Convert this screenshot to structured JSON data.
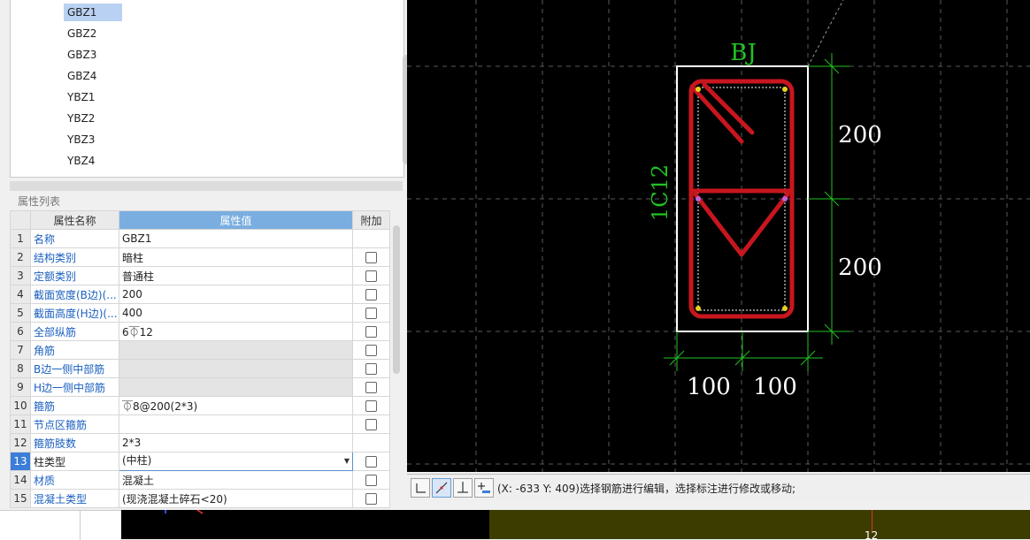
{
  "tree": {
    "items": [
      "GBZ1",
      "GBZ2",
      "GBZ3",
      "GBZ4",
      "YBZ1",
      "YBZ2",
      "YBZ3",
      "YBZ4"
    ],
    "selected_index": 0
  },
  "props": {
    "title": "属性列表",
    "col_name": "属性名称",
    "col_value": "属性值",
    "col_extra": "附加",
    "rows": [
      {
        "num": "1",
        "name": "名称",
        "value": "GBZ1"
      },
      {
        "num": "2",
        "name": "结构类别",
        "value": "暗柱"
      },
      {
        "num": "3",
        "name": "定额类别",
        "value": "普通柱"
      },
      {
        "num": "4",
        "name": "截面宽度(B边)(...",
        "value": "200"
      },
      {
        "num": "5",
        "name": "截面高度(H边)(...",
        "value": "400"
      },
      {
        "num": "6",
        "name": "全部纵筋",
        "value": "6⏁12"
      },
      {
        "num": "7",
        "name": "角筋",
        "value": ""
      },
      {
        "num": "8",
        "name": "B边一侧中部筋",
        "value": ""
      },
      {
        "num": "9",
        "name": "H边一侧中部筋",
        "value": ""
      },
      {
        "num": "10",
        "name": "箍筋",
        "value": "⏁8@200(2*3)"
      },
      {
        "num": "11",
        "name": "节点区箍筋",
        "value": ""
      },
      {
        "num": "12",
        "name": "箍筋肢数",
        "value": "2*3"
      },
      {
        "num": "13",
        "name": "柱类型",
        "value": "(中柱)"
      },
      {
        "num": "14",
        "name": "材质",
        "value": "混凝土"
      },
      {
        "num": "15",
        "name": "混凝土类型",
        "value": "(现浇混凝土碎石<20)"
      }
    ]
  },
  "drawing": {
    "label_top": "BJ",
    "label_side": "1C12",
    "dim_right_top": "200",
    "dim_right_bottom": "200",
    "dim_bottom_left": "100",
    "dim_bottom_right": "100",
    "bottom_mark": "12"
  },
  "status": {
    "text": "(X: -633 Y: 409)选择钢筋进行编辑，选择标注进行修改或移动;"
  },
  "colors": {
    "rebar": "#c8161e",
    "dim": "#22c322",
    "grid": "#5a5a5a"
  }
}
